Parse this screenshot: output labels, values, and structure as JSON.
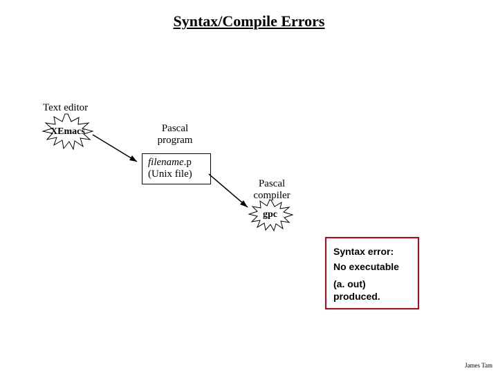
{
  "title": "Syntax/Compile Errors",
  "editor": {
    "caption": "Text editor",
    "name": "XEmacs"
  },
  "program": {
    "caption_line1": "Pascal",
    "caption_line2": "program",
    "file_line1_italic": "filename",
    "file_line1_rest": ".p",
    "file_line2": "(Unix file)"
  },
  "compiler": {
    "caption_line1": "Pascal",
    "caption_line2": "compiler",
    "name": "gpc"
  },
  "error": {
    "line1": "Syntax error:",
    "line2": "No executable",
    "line3": "(a. out)",
    "line4": "produced."
  },
  "footer": "James Tam"
}
